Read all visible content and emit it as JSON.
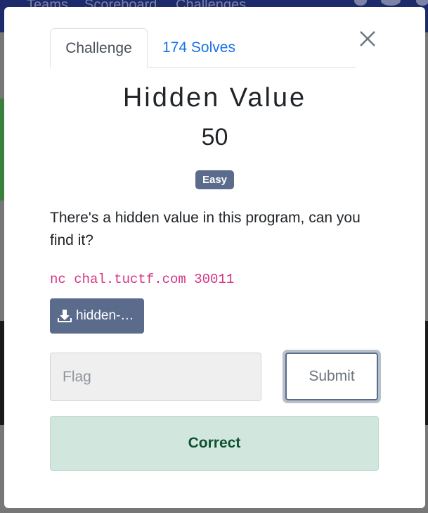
{
  "background": {
    "nav_links": [
      "Teams",
      "Scoreboard",
      "Challenges"
    ]
  },
  "modal": {
    "tabs": [
      {
        "label": "Challenge",
        "active": true
      },
      {
        "label": "174 Solves",
        "active": false
      }
    ],
    "close_icon": "close-icon",
    "title": "Hidden Value",
    "value": "50",
    "badge": "Easy",
    "description": "There's a hidden value in this program, can you find it?",
    "connection": "nc chal.tuctf.com 30011",
    "file": {
      "icon": "download-icon",
      "label": "hidden-…"
    },
    "flag_input": {
      "placeholder": "Flag",
      "value": ""
    },
    "submit_label": "Submit",
    "result": "Correct"
  },
  "colors": {
    "tab_link": "#1a73e8",
    "badge_bg": "#5b6b8c",
    "code": "#d63384",
    "alert_bg": "#d1e7dd",
    "alert_text": "#0f5132"
  }
}
